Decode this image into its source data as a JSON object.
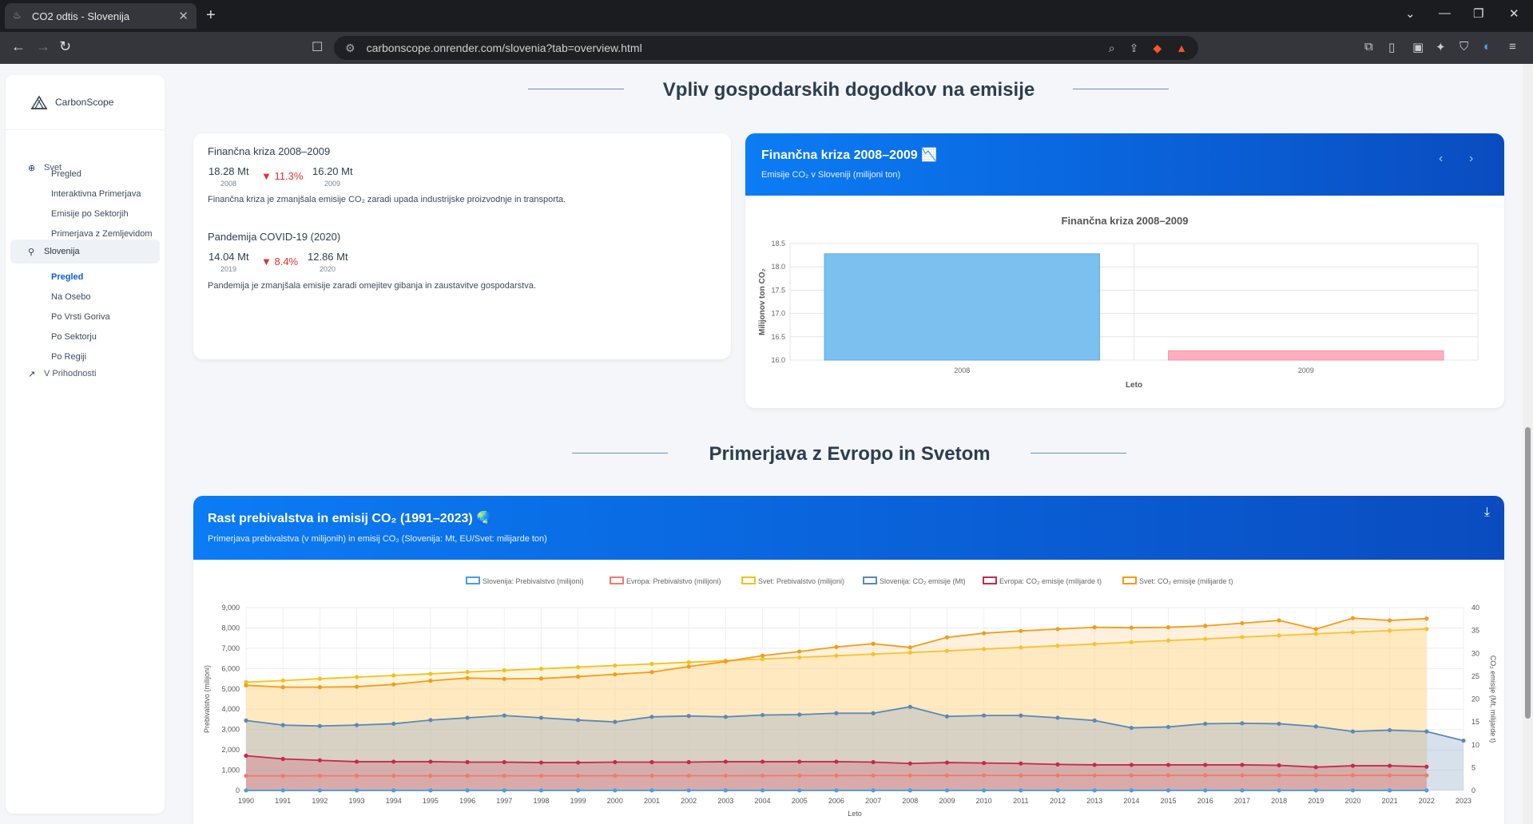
{
  "browser": {
    "tab_title": "CO2 odtis - Slovenija",
    "url": "carbonscope.onrender.com/slovenia?tab=overview.html"
  },
  "sidebar": {
    "brand": "CarbonScope",
    "svet": "Svet",
    "svet_items": [
      "Pregled",
      "Interaktivna Primerjava",
      "Emisije po Sektorjih",
      "Primerjava z Zemljevidom"
    ],
    "slovenija": "Slovenija",
    "slo_items": [
      "Pregled",
      "Na Osebo",
      "Po Vrsti Goriva",
      "Po Sektorju",
      "Po Regiji"
    ],
    "future": "V Prihodnosti"
  },
  "section1": {
    "title": "Vpliv gospodarskih dogodkov na emisije"
  },
  "events": {
    "crisis": {
      "title": "Finančna kriza 2008–2009",
      "v1": "18.28 Mt",
      "y1": "2008",
      "pct": "▼ 11.3%",
      "v2": "16.20 Mt",
      "y2": "2009",
      "desc": "Finančna kriza je zmanjšala emisije CO₂ zaradi upada industrijske proizvodnje in transporta."
    },
    "covid": {
      "title": "Pandemija COVID-19 (2020)",
      "v1": "14.04 Mt",
      "y1": "2019",
      "pct": "▼ 8.4%",
      "v2": "12.86 Mt",
      "y2": "2020",
      "desc": "Pandemija je zmanjšala emisije zaradi omejitev gibanja in zaustavitve gospodarstva."
    }
  },
  "crisis_card": {
    "title": "Finančna kriza 2008–2009 📉",
    "subtitle": "Emisije CO₂ v Sloveniji (milijoni ton)",
    "prev": "‹",
    "next": "›"
  },
  "section2": {
    "title": "Primerjava z Evropo in Svetom"
  },
  "pop_card": {
    "title": "Rast prebivalstva in emisij CO₂ (1991–2023) 🌏",
    "subtitle": "Primerjava prebivalstva (v milijonih) in emisij CO₂ (Slovenija: Mt, EU/Svet: milijarde ton)"
  },
  "chart_data": [
    {
      "type": "bar",
      "title": "Finančna kriza 2008–2009",
      "categories": [
        "2008",
        "2009"
      ],
      "values": [
        18.28,
        16.2
      ],
      "colors": [
        "#7cc0f0",
        "#ffaec0"
      ],
      "xlabel": "Leto",
      "ylabel": "Milijonov ton CO₂",
      "ylim": [
        16.0,
        18.5
      ],
      "yticks": [
        "18.5",
        "18.0",
        "17.5",
        "17.0",
        "16.5",
        "16.0"
      ],
      "grid": true
    },
    {
      "type": "line",
      "x": [
        "1990",
        "1991",
        "1992",
        "1993",
        "1994",
        "1995",
        "1996",
        "1997",
        "1998",
        "1999",
        "2000",
        "2001",
        "2002",
        "2003",
        "2004",
        "2005",
        "2006",
        "2007",
        "2008",
        "2009",
        "2010",
        "2011",
        "2012",
        "2013",
        "2014",
        "2015",
        "2016",
        "2017",
        "2018",
        "2019",
        "2020",
        "2021",
        "2022",
        "2023"
      ],
      "xlabel": "Leto",
      "ylabel_left": "Prebivalstvo (milijoni)",
      "ylabel_right": "CO₂ emisije (Mt, milijarde t)",
      "yticks_left": [
        "9,000",
        "8,000",
        "7,000",
        "6,000",
        "5,000",
        "4,000",
        "3,000",
        "2,000",
        "1,000",
        "0"
      ],
      "yticks_right": [
        "40",
        "35",
        "30",
        "25",
        "20",
        "15",
        "10",
        "5",
        "0"
      ],
      "ylim_left": [
        0,
        9000
      ],
      "ylim_right": [
        0,
        40
      ],
      "legend_position": "top",
      "series": [
        {
          "name": "Slovenija: Prebivalstvo (milijoni)",
          "axis": "left",
          "color": "#4a9be8",
          "values": [
            2,
            2,
            2,
            2,
            2,
            2,
            2,
            2,
            2,
            2,
            2,
            2,
            2,
            2,
            2,
            2,
            2,
            2,
            2,
            2,
            2,
            2,
            2,
            2,
            2,
            2,
            2,
            2,
            2,
            2,
            2,
            2,
            2
          ]
        },
        {
          "name": "Evropa: Prebivalstvo (milijoni)",
          "axis": "left",
          "color": "#ee7b6d",
          "values": [
            720,
            720,
            722,
            722,
            722,
            722,
            722,
            722,
            724,
            724,
            726,
            726,
            727,
            728,
            730,
            732,
            734,
            736,
            738,
            740,
            741,
            742,
            743,
            744,
            745,
            746,
            746,
            746,
            747,
            747,
            747,
            746,
            745
          ]
        },
        {
          "name": "Svet: Prebivalstvo (milijoni)",
          "axis": "left",
          "color": "#f2c21a",
          "values": [
            5330,
            5410,
            5500,
            5580,
            5660,
            5740,
            5830,
            5910,
            5990,
            6070,
            6150,
            6230,
            6310,
            6390,
            6470,
            6550,
            6630,
            6710,
            6790,
            6870,
            6960,
            7040,
            7120,
            7210,
            7300,
            7380,
            7460,
            7550,
            7630,
            7710,
            7790,
            7870,
            7950
          ]
        },
        {
          "name": "Slovenija: CO₂ emisije (Mt)",
          "axis": "right",
          "color": "#5a88b8",
          "values": [
            15.3,
            14.3,
            14.1,
            14.3,
            14.6,
            15.4,
            15.9,
            16.4,
            15.9,
            15.4,
            15.0,
            16.1,
            16.3,
            16.1,
            16.5,
            16.6,
            16.9,
            16.9,
            18.3,
            16.2,
            16.4,
            16.4,
            15.9,
            15.3,
            13.7,
            13.9,
            14.6,
            14.7,
            14.6,
            14.0,
            12.9,
            13.2,
            12.9,
            10.9
          ]
        },
        {
          "name": "Evropa: CO₂ emisije (milijarde t)",
          "axis": "right",
          "color": "#c8284a",
          "values": [
            7.6,
            6.9,
            6.6,
            6.3,
            6.3,
            6.3,
            6.2,
            6.2,
            6.1,
            6.1,
            6.2,
            6.2,
            6.2,
            6.3,
            6.3,
            6.3,
            6.3,
            6.2,
            5.9,
            6.1,
            6.0,
            5.9,
            5.7,
            5.6,
            5.6,
            5.6,
            5.6,
            5.6,
            5.5,
            5.1,
            5.4,
            5.4,
            5.2
          ]
        },
        {
          "name": "Svet: CO₂ emisije (milijarde t)",
          "axis": "right",
          "color": "#f39c1a",
          "values": [
            23.0,
            22.6,
            22.6,
            22.7,
            23.2,
            24.0,
            24.6,
            24.4,
            24.5,
            24.9,
            25.4,
            25.9,
            27.1,
            28.2,
            29.5,
            30.4,
            31.4,
            32.1,
            31.3,
            33.5,
            34.4,
            34.9,
            35.3,
            35.7,
            35.6,
            35.7,
            36.0,
            36.6,
            37.2,
            35.3,
            37.7,
            37.2,
            37.6
          ]
        }
      ]
    }
  ]
}
